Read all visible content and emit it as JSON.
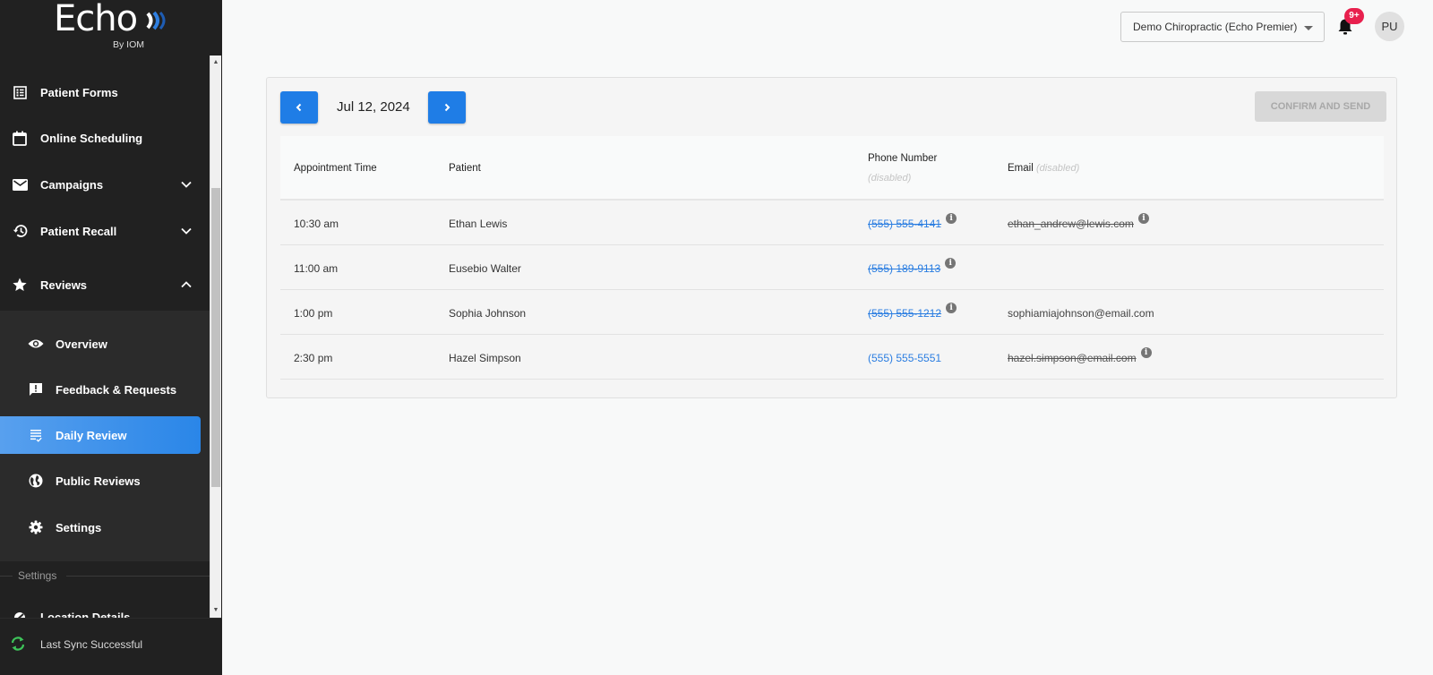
{
  "brand": {
    "name": "Echo",
    "tagline": "By IOM",
    "accent": "#1f7de6"
  },
  "sidebar": {
    "items": [
      {
        "label": "Patient Forms",
        "icon": "form-list-icon"
      },
      {
        "label": "Online Scheduling",
        "icon": "calendar-icon"
      },
      {
        "label": "Campaigns",
        "icon": "mail-icon",
        "expandable": true,
        "expanded": false
      },
      {
        "label": "Patient Recall",
        "icon": "history-icon",
        "expandable": true,
        "expanded": false
      },
      {
        "label": "Reviews",
        "icon": "star-icon",
        "expandable": true,
        "expanded": true
      }
    ],
    "reviews_sub": [
      {
        "label": "Overview",
        "icon": "eye-icon",
        "active": false
      },
      {
        "label": "Feedback & Requests",
        "icon": "feedback-icon",
        "active": false
      },
      {
        "label": "Daily Review",
        "icon": "checklist-icon",
        "active": true
      },
      {
        "label": "Public Reviews",
        "icon": "globe-icon",
        "active": false
      },
      {
        "label": "Settings",
        "icon": "gear-icon",
        "active": false
      }
    ],
    "section_label": "Settings",
    "partial_item": "Location Details",
    "sync_status": "Last Sync Successful"
  },
  "topbar": {
    "location": "Demo Chiropractic (Echo Premier)",
    "notification_badge": "9+",
    "avatar_initials": "PU"
  },
  "daily_review": {
    "date": "Jul 12, 2024",
    "confirm_label": "CONFIRM AND SEND",
    "columns": {
      "time": "Appointment Time",
      "patient": "Patient",
      "phone": "Phone Number",
      "phone_note": "(disabled)",
      "email": "Email",
      "email_note": "(disabled)"
    },
    "rows": [
      {
        "time": "10:30 am",
        "patient": "Ethan Lewis",
        "phone": "(555) 555-4141",
        "phone_disabled": true,
        "email": "ethan_andrew@lewis.com",
        "email_disabled": true
      },
      {
        "time": "11:00 am",
        "patient": "Eusebio Walter",
        "phone": "(555) 189-9113",
        "phone_disabled": true,
        "email": "",
        "email_disabled": false
      },
      {
        "time": "1:00 pm",
        "patient": "Sophia Johnson",
        "phone": "(555) 555-1212",
        "phone_disabled": true,
        "email": "sophiamiajohnson@email.com",
        "email_disabled": false
      },
      {
        "time": "2:30 pm",
        "patient": "Hazel Simpson",
        "phone": "(555) 555-5551",
        "phone_disabled": false,
        "email": "hazel.simpson@email.com",
        "email_disabled": true
      }
    ]
  }
}
